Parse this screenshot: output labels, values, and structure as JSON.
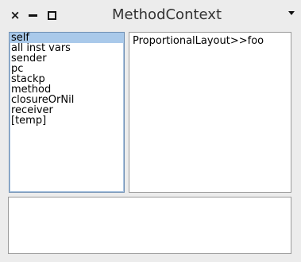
{
  "window": {
    "title": "MethodContext",
    "close_glyph": "×",
    "minimize_icon": "minimize-icon",
    "maximize_icon": "maximize-icon",
    "menu_icon": "window-menu-icon"
  },
  "inspector": {
    "fields": [
      {
        "label": "self",
        "selected": true
      },
      {
        "label": "all inst vars",
        "selected": false
      },
      {
        "label": "sender",
        "selected": false
      },
      {
        "label": "pc",
        "selected": false
      },
      {
        "label": "stackp",
        "selected": false
      },
      {
        "label": "method",
        "selected": false
      },
      {
        "label": "closureOrNil",
        "selected": false
      },
      {
        "label": "receiver",
        "selected": false
      },
      {
        "label": "[temp]",
        "selected": false
      }
    ],
    "value_text": "ProportionalLayout>>foo",
    "eval_text": ""
  },
  "colors": {
    "selection": "#a9c9ea",
    "focus_border": "#6f8fb3"
  }
}
